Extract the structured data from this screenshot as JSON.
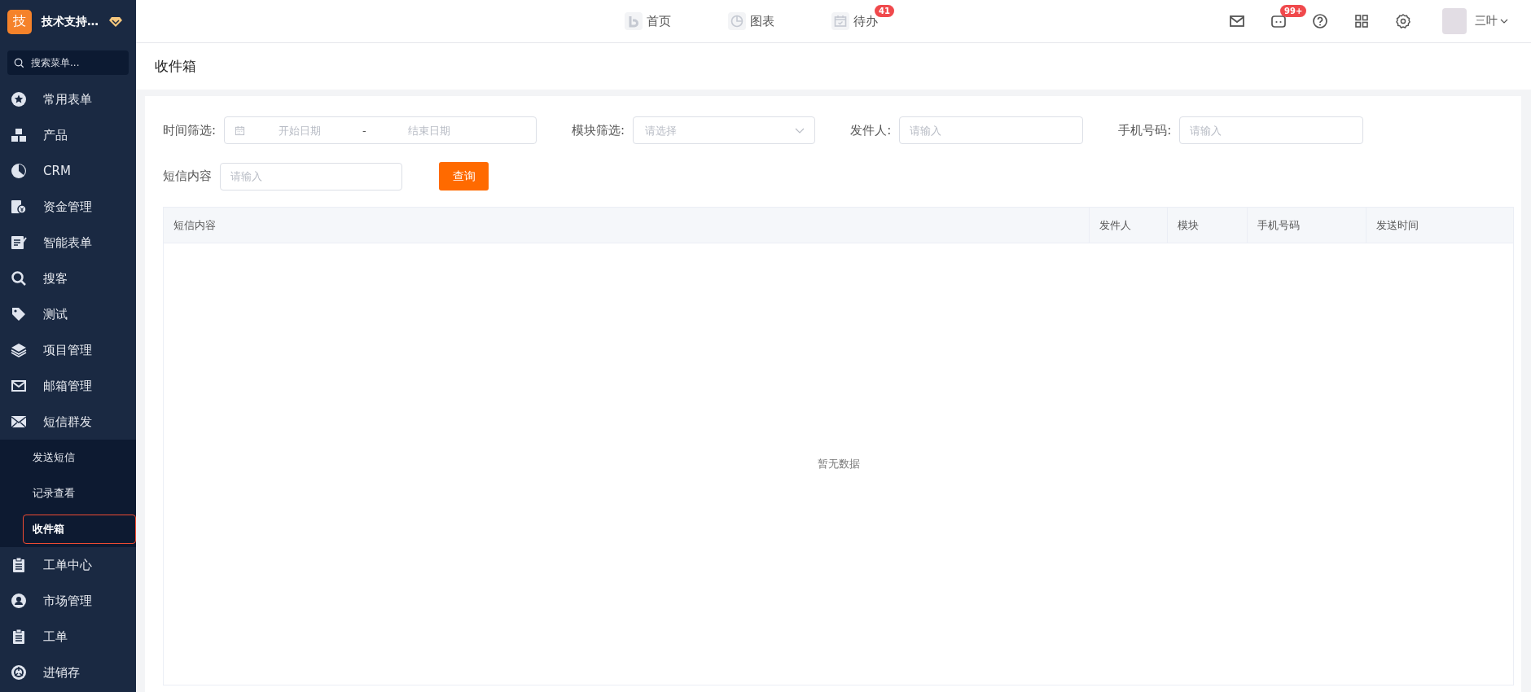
{
  "sidebar": {
    "logo_char": "技",
    "org_name": "技术支持…",
    "search": {
      "placeholder": "搜索菜单..."
    },
    "items": [
      {
        "label": "常用表单"
      },
      {
        "label": "产品"
      },
      {
        "label": "CRM"
      },
      {
        "label": "资金管理"
      },
      {
        "label": "智能表单"
      },
      {
        "label": "搜客"
      },
      {
        "label": "测试"
      },
      {
        "label": "项目管理"
      },
      {
        "label": "邮箱管理"
      },
      {
        "label": "短信群发",
        "expanded": true,
        "children": [
          {
            "label": "发送短信",
            "selected": false
          },
          {
            "label": "记录查看",
            "selected": false
          },
          {
            "label": "收件箱",
            "selected": true
          }
        ]
      },
      {
        "label": "工单中心"
      },
      {
        "label": "市场管理"
      },
      {
        "label": "工单"
      },
      {
        "label": "进销存"
      }
    ]
  },
  "top_nav": {
    "tabs": [
      {
        "label": "首页"
      },
      {
        "label": "图表"
      },
      {
        "label": "待办",
        "badge": "41"
      }
    ],
    "message_badge": "99+",
    "user_name": "三叶"
  },
  "page_title": "收件箱",
  "filters": [
    {
      "kind": "daterange",
      "label": "时间筛选:",
      "start_placeholder": "开始日期",
      "separator": "-",
      "end_placeholder": "结束日期"
    },
    {
      "kind": "select",
      "label": "模块筛选:",
      "placeholder": "请选择"
    },
    {
      "kind": "input",
      "label": "发件人:",
      "placeholder": "请输入"
    },
    {
      "kind": "input",
      "label": "手机号码:",
      "placeholder": "请输入"
    },
    {
      "kind": "input",
      "label": "短信内容",
      "placeholder": "请输入"
    }
  ],
  "query_button": "查询",
  "table": {
    "columns": [
      "短信内容",
      "发件人",
      "模块",
      "手机号码",
      "发送时间"
    ],
    "empty_text": "暂无数据"
  }
}
